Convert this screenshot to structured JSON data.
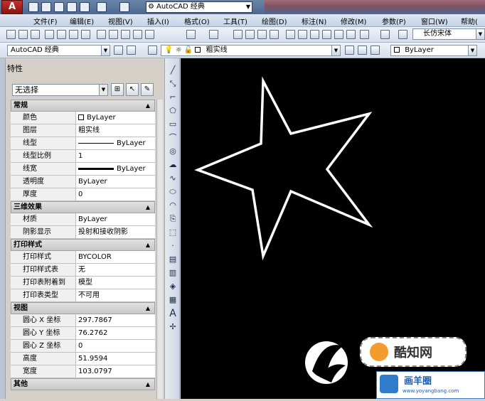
{
  "titlebar": {
    "app_button": "A",
    "workspace": "AutoCAD 经典"
  },
  "menubar": {
    "items": [
      "文件(F)",
      "编辑(E)",
      "视图(V)",
      "插入(I)",
      "格式(O)",
      "工具(T)",
      "绘图(D)",
      "标注(N)",
      "修改(M)",
      "参数(P)",
      "窗口(W)",
      "帮助("
    ]
  },
  "toolbar2": {
    "font_combo": "长仿宋体"
  },
  "toolbar3": {
    "workspace_combo": "AutoCAD 经典",
    "layer_combo": "粗实线",
    "color_combo": "ByLayer"
  },
  "properties": {
    "title": "特性",
    "selection": "无选择",
    "sections": [
      {
        "title": "常规",
        "rows": [
          {
            "key": "颜色",
            "value": "ByLayer",
            "swatch": "square"
          },
          {
            "key": "图层",
            "value": "粗实线"
          },
          {
            "key": "线型",
            "value": "ByLayer",
            "swatch": "line"
          },
          {
            "key": "线型比例",
            "value": "1"
          },
          {
            "key": "线宽",
            "value": "ByLayer",
            "swatch": "thick"
          },
          {
            "key": "透明度",
            "value": "ByLayer"
          },
          {
            "key": "厚度",
            "value": "0"
          }
        ]
      },
      {
        "title": "三维效果",
        "rows": [
          {
            "key": "材质",
            "value": "ByLayer"
          },
          {
            "key": "阴影显示",
            "value": "投射和接收阴影"
          }
        ]
      },
      {
        "title": "打印样式",
        "rows": [
          {
            "key": "打印样式",
            "value": "BYCOLOR"
          },
          {
            "key": "打印样式表",
            "value": "无"
          },
          {
            "key": "打印表附着到",
            "value": "模型"
          },
          {
            "key": "打印表类型",
            "value": "不可用"
          }
        ]
      },
      {
        "title": "视图",
        "rows": [
          {
            "key": "圆心 X 坐标",
            "value": "297.7867"
          },
          {
            "key": "圆心 Y 坐标",
            "value": "76.2762"
          },
          {
            "key": "圆心 Z 坐标",
            "value": "0"
          },
          {
            "key": "高度",
            "value": "51.9594"
          },
          {
            "key": "宽度",
            "value": "103.0797"
          }
        ]
      },
      {
        "title": "其他",
        "rows": []
      }
    ]
  },
  "watermark": {
    "brand": "酷知网",
    "site_cn": "画羊圈",
    "site_url": "www.yoyangbang.com"
  },
  "colors": {
    "canvas": "#000000",
    "star_stroke": "#ffffff",
    "accent": "#4d6790"
  }
}
